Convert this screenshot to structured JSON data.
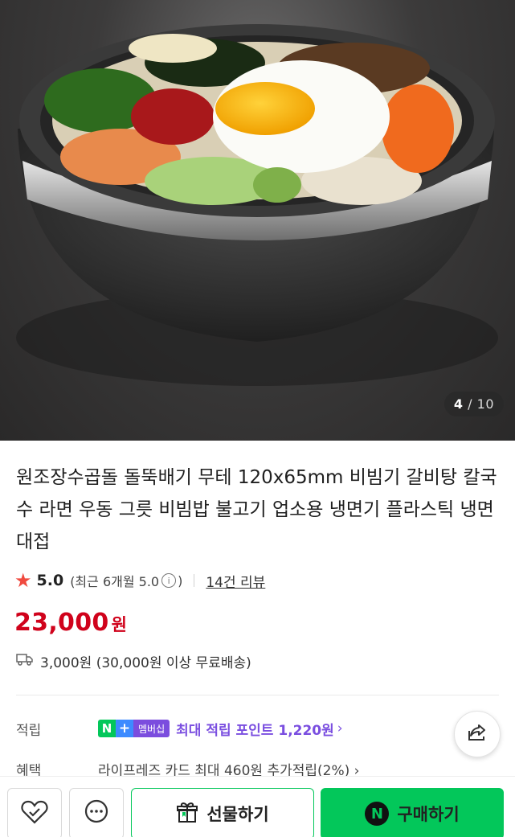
{
  "gallery": {
    "current": "4",
    "separator": "/",
    "total": "10",
    "image_alt_subject": "bibimbap-in-stone-pot"
  },
  "product": {
    "title": "원조장수곱돌 돌뚝배기 무테 120x65mm 비빔기 갈비탕 칼국수 라면 우동 그릇 비빔밥 불고기 업소용 냉면기 플라스틱 냉면 대접",
    "rating": "5.0",
    "recent_rating_prefix": "(최근 6개월 5.0",
    "recent_rating_suffix": ")",
    "review_link": "14건 리뷰",
    "price": "23,000",
    "price_unit": "원",
    "shipping": "3,000원 (30,000원 이상 무료배송)"
  },
  "points": {
    "label": "적립",
    "badge_n": "N",
    "badge_plus": "+",
    "badge_member": "멤버십",
    "text": "최대 적립 포인트 1,220원",
    "chevron": "›"
  },
  "benefit": {
    "label": "혜택",
    "text": "라이프레즈 카드 최대 460원 추가적립(2%) ›"
  },
  "bottom_bar": {
    "gift_label": "선물하기",
    "buy_label": "구매하기",
    "buy_icon": "N"
  },
  "colors": {
    "price": "#d0021b",
    "naver_green": "#03c75a",
    "points_purple": "#7a4ee0",
    "star": "#f04a3f"
  },
  "icons": [
    "star-icon",
    "info-icon",
    "truck-icon",
    "share-icon",
    "heart-check-icon",
    "chat-icon",
    "gift-icon",
    "naver-n-icon"
  ]
}
